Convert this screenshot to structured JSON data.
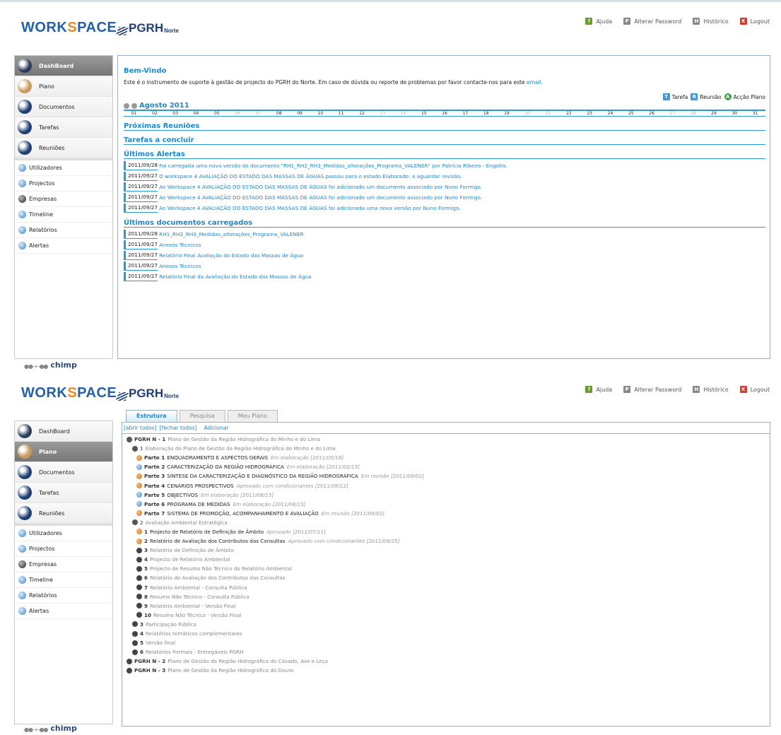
{
  "brand": {
    "workspace_a": "WORK",
    "workspace_b": "S",
    "workspace_c": "PACE",
    "pgrh": "PGRH",
    "norte": "Norte",
    "chimp": "chimp"
  },
  "toplinks": [
    {
      "label": "Ajuda",
      "icon": "help-icon",
      "color": "#6b9a2f"
    },
    {
      "label": "Alterar Password",
      "icon": "password-icon",
      "color": "#888888"
    },
    {
      "label": "Histórico",
      "icon": "history-icon",
      "color": "#888888"
    },
    {
      "label": "Logout",
      "icon": "logout-icon",
      "color": "#d63a2e"
    }
  ],
  "nav_main": [
    {
      "label": "DashBoard",
      "icon": "dashboard-icon"
    },
    {
      "label": "Plano",
      "icon": "plano-icon"
    },
    {
      "label": "Documentos",
      "icon": "documents-icon"
    },
    {
      "label": "Tarefas",
      "icon": "tasks-icon"
    },
    {
      "label": "Reuniões",
      "icon": "meetings-icon"
    }
  ],
  "nav_admin": [
    {
      "label": "Utilizadores",
      "icon": "users-icon"
    },
    {
      "label": "Projectos",
      "icon": "projects-icon"
    },
    {
      "label": "Empresas",
      "icon": "companies-icon"
    },
    {
      "label": "Timeline",
      "icon": "timeline-icon"
    },
    {
      "label": "Relatórios",
      "icon": "reports-icon"
    },
    {
      "label": "Alertas",
      "icon": "alerts-icon"
    }
  ],
  "dashboard": {
    "welcome_title": "Bem-Vindo",
    "welcome_text": "Este é o instrumento de suporte à gestão de projecto do PGRH do Norte. Em caso de dúvida ou reporte de problemas por favor contacte-nos para este",
    "welcome_link": "email",
    "welcome_end": ".",
    "legend": [
      {
        "label": "Tarefa",
        "letter": "T",
        "color": "#3a9ad9"
      },
      {
        "label": "Reunião",
        "letter": "R",
        "color": "#3a9ad9"
      },
      {
        "label": "Acção Plano",
        "letter": "A",
        "color": "#3aa04a"
      }
    ],
    "month": "Agosto 2011",
    "days": [
      "01",
      "02",
      "03",
      "04",
      "05",
      "06",
      "07",
      "08",
      "09",
      "10",
      "11",
      "12",
      "13",
      "14",
      "15",
      "16",
      "17",
      "18",
      "19",
      "20",
      "21",
      "22",
      "23",
      "24",
      "25",
      "26",
      "27",
      "28",
      "29",
      "30",
      "31"
    ],
    "weekend_days": [
      "06",
      "07",
      "13",
      "14",
      "20",
      "21",
      "27",
      "28"
    ],
    "sections": {
      "reunioes": "Próximas Reuniões",
      "tarefas": "Tarefas a concluir",
      "alertas": "Últimos Alertas",
      "docs": "Últimos documentos carregados"
    },
    "alerts": [
      {
        "date": "2011/09/28",
        "text": "Foi carregada uma nova versão do documento \"RH1_RH2_RH3_Medidas_alterações_Programa_VALENER\" por Patrícia Ribeiro - Engidro."
      },
      {
        "date": "2011/09/27",
        "text": "O workspace 4 AVALIAÇÃO DO ESTADO DAS MASSAS DE ÁGUAS passou para o estado Elaborado: a aguardar revisão."
      },
      {
        "date": "2011/09/27",
        "text": "Ao Workspace 4 AVALIAÇÃO DO ESTADO DAS MASSAS DE ÁGUAS foi adicionado um documento associado por Nuno Formigo."
      },
      {
        "date": "2011/09/27",
        "text": "Ao Workspace 4 AVALIAÇÃO DO ESTADO DAS MASSAS DE ÁGUAS foi adicionado um documento associado por Nuno Formigo."
      },
      {
        "date": "2011/09/27",
        "text": "Ao Workspace 4 AVALIAÇÃO DO ESTADO DAS MASSAS DE ÁGUAS foi adicionada uma nova versão por Nuno Formigo."
      }
    ],
    "docs": [
      {
        "date": "2011/09/28",
        "text": "RH1_RH2_RH3_Medidas_alterações_Programa_VALENER"
      },
      {
        "date": "2011/09/27",
        "text": "Anexos Técnicos"
      },
      {
        "date": "2011/09/27",
        "text": "Relatório Final Avaliação do Estado das Massas de Água"
      },
      {
        "date": "2011/09/27",
        "text": "Anexos Técnicos"
      },
      {
        "date": "2011/09/27",
        "text": "Relatório Final da Avaliação do Estado das Massas de Água"
      }
    ]
  },
  "plano": {
    "tabs": [
      "Estrutura",
      "Pesquisa",
      "Meu Plano"
    ],
    "tools": {
      "open_all": "[abrir todos]",
      "close_all": "[fechar todos]",
      "add": "Adicionar"
    },
    "tree": [
      {
        "level": 0,
        "icon": "exp",
        "num": "PGRH N - 1",
        "title": "Plano de Gestão da Região Hidrográfica do Minho e do Lima"
      },
      {
        "level": 1,
        "icon": "exp",
        "num": "1",
        "plain": true,
        "title": "Elaboração do Plano de Gestão da Região Hidrográfica do Minho e do Lima"
      },
      {
        "level": 2,
        "icon": "orange",
        "num": "Parte 1",
        "title": "ENQUADRAMENTO E ASPECTOS GERAIS",
        "dark": true,
        "status": "Em elaboração [2011/09/16]"
      },
      {
        "level": 2,
        "icon": "blue",
        "num": "Parte 2",
        "title": "CARACTERIZAÇÃO DA REGIÃO HIDROGRÁFICA",
        "dark": true,
        "status": "Em elaboração [2011/02/15]"
      },
      {
        "level": 2,
        "icon": "orange",
        "num": "Parte 3",
        "title": "SÍNTESE DA CARACTERIZAÇÃO E DIAGNÓSTICO DA REGIÃO HIDROGRÁFICA",
        "dark": true,
        "status": "Em revisão [2011/09/02]"
      },
      {
        "level": 2,
        "icon": "orange",
        "num": "Parte 4",
        "title": "CENÁRIOS PROSPECTIVOS",
        "dark": true,
        "status": "Aprovado com condicionantes [2011/08/12]"
      },
      {
        "level": 2,
        "icon": "blue",
        "num": "Parte 5",
        "title": "OBJECTIVOS",
        "dark": true,
        "status": "Em elaboração [2011/08/15]"
      },
      {
        "level": 2,
        "icon": "blue",
        "num": "Parte 6",
        "title": "PROGRAMA DE MEDIDAS",
        "dark": true,
        "status": "Em elaboração [2011/08/15]"
      },
      {
        "level": 2,
        "icon": "orange",
        "num": "Parte 7",
        "title": "SISTEMA DE PROMOÇÃO, ACOMPANHAMENTO E AVALIAÇÃO",
        "dark": true,
        "status": "Em revisão [2011/09/02]"
      },
      {
        "level": 1,
        "icon": "exp",
        "num": "2",
        "plain": true,
        "title": "Avaliação Ambiental Estratégica"
      },
      {
        "level": 2,
        "icon": "orange",
        "num": "1",
        "title": "Projecto de Relatório de Definição de Âmbito",
        "dark": true,
        "status": "Aprovado [2011/07/11]"
      },
      {
        "level": 2,
        "icon": "orange",
        "num": "2",
        "title": "Relatório de Avaliação dos Contributos das Consultas",
        "dark": true,
        "status": "Aprovado com condicionantes [2011/08/25]"
      },
      {
        "level": 2,
        "icon": "dark",
        "num": "3",
        "title": "Relatório de Definição de Âmbito"
      },
      {
        "level": 2,
        "icon": "dark",
        "num": "4",
        "title": "Projecto de Relatório Ambiental"
      },
      {
        "level": 2,
        "icon": "dark",
        "num": "5",
        "title": "Projecto de Resumo Não Técnico do Relatório Ambiental"
      },
      {
        "level": 2,
        "icon": "dark",
        "num": "6",
        "title": "Relatório de Avaliação dos Contributos das Consultas"
      },
      {
        "level": 2,
        "icon": "dark",
        "num": "7",
        "title": "Relatório Ambiental - Consulta Pública"
      },
      {
        "level": 2,
        "icon": "dark",
        "num": "8",
        "title": "Resumo Não Técnico - Consulta Pública"
      },
      {
        "level": 2,
        "icon": "dark",
        "num": "9",
        "title": "Relatório Ambiental - Versão Final"
      },
      {
        "level": 2,
        "icon": "dark",
        "num": "10",
        "title": "Resumo Não Técnico - Versão Final"
      },
      {
        "level": 1,
        "icon": "dark",
        "num": "3",
        "title": "Participação Pública"
      },
      {
        "level": 1,
        "icon": "dark",
        "num": "4",
        "title": "Relatórios temáticos complementares"
      },
      {
        "level": 1,
        "icon": "dark",
        "num": "5",
        "title": "Versão final"
      },
      {
        "level": 1,
        "icon": "dark",
        "num": "6",
        "title": "Relatórios Formais - Entregáveis PGRH"
      },
      {
        "level": 0,
        "icon": "dark",
        "num": "PGRH N - 2",
        "title": "Plano de Gestão da Região Hidrográfica do Cávado, Ave e Leça"
      },
      {
        "level": 0,
        "icon": "dark",
        "num": "PGRH N - 3",
        "title": "Plano de Gestão da Região Hidrográfica do Douro"
      }
    ]
  }
}
